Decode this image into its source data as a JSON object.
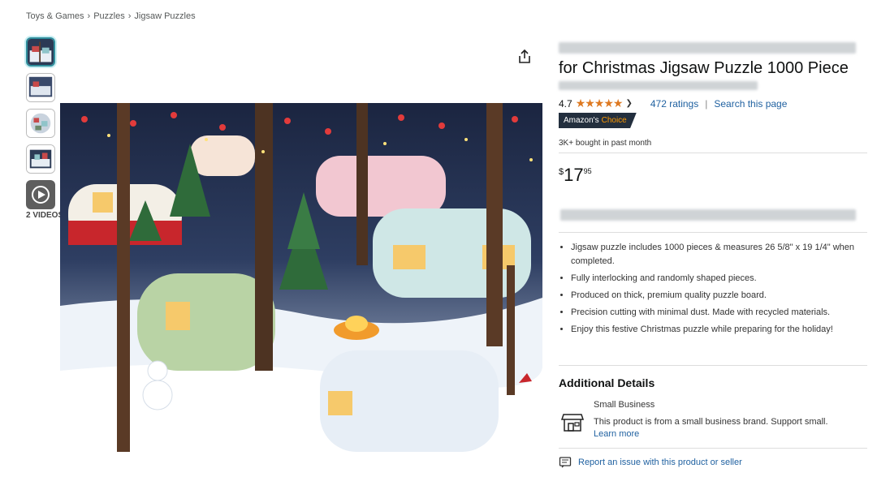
{
  "breadcrumb": {
    "items": [
      "Toys & Games",
      "Puzzles",
      "Jigsaw Puzzles"
    ],
    "separator": "›"
  },
  "gallery": {
    "video_label": "2 VIDEOS",
    "thumb_count": 4
  },
  "product": {
    "title": "for Christmas Jigsaw Puzzle 1000 Piece",
    "rating_value": "4.7",
    "stars": "★★★★★",
    "ratings_link": "472 ratings",
    "search_link": "Search this page",
    "badge_prefix": "Amazon's",
    "badge_choice": "Choice",
    "bought": "3K+ bought in past month",
    "price_symbol": "$",
    "price_whole": "17",
    "price_fraction": "95",
    "bullets": [
      "Jigsaw puzzle includes 1000 pieces & measures 26 5/8\" x 19 1/4\" when completed.",
      "Fully interlocking and randomly shaped pieces.",
      "Produced on thick, premium quality puzzle board.",
      "Precision cutting with minimal dust. Made with recycled materials.",
      "Enjoy this festive Christmas puzzle while preparing for the holiday!"
    ]
  },
  "additional": {
    "title": "Additional Details",
    "small_business_title": "Small Business",
    "small_business_desc": "This product is from a small business brand. Support small.",
    "learn_more": "Learn more"
  },
  "report": {
    "label": "Report an issue with this product or seller"
  },
  "colors": {
    "link": "#2162a1",
    "star": "#de7921",
    "badge_bg": "#232f3e",
    "badge_accent": "#ff9900"
  }
}
